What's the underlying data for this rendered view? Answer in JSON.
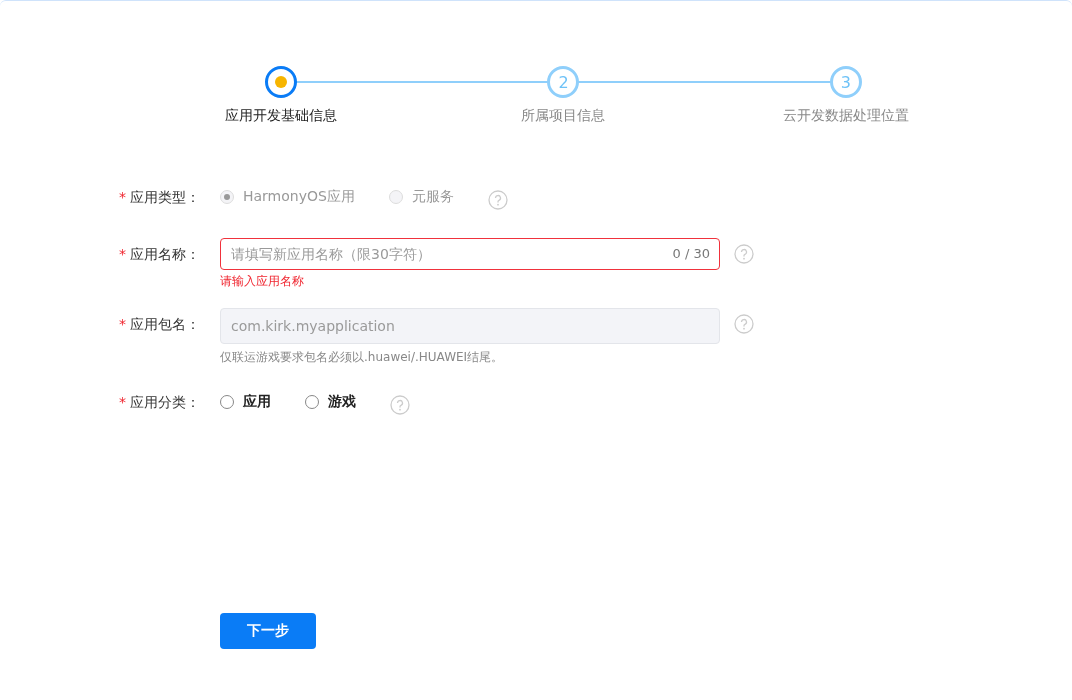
{
  "steps": [
    {
      "label": "应用开发基础信息",
      "current": true
    },
    {
      "label": "所属项目信息",
      "number": "2",
      "current": false
    },
    {
      "label": "云开发数据处理位置",
      "number": "3",
      "current": false
    }
  ],
  "form": {
    "rows": [
      {
        "kind": "radio",
        "label": "应用类型：",
        "required_mark": "*",
        "disabled": true,
        "options": [
          {
            "label": "HarmonyOS应用",
            "selected": true
          },
          {
            "label": "元服务",
            "selected": false
          }
        ]
      },
      {
        "kind": "input",
        "label": "应用名称：",
        "required_mark": "*",
        "placeholder": "请填写新应用名称（限30字符）",
        "counter": "0 / 30",
        "error": "请输入应用名称"
      },
      {
        "kind": "readonly",
        "label": "应用包名：",
        "required_mark": "*",
        "value": "com.kirk.myapplication",
        "hint": "仅联运游戏要求包名必须以.huawei/.HUAWEI结尾。"
      },
      {
        "kind": "radio",
        "label": "应用分类：",
        "required_mark": "*",
        "disabled": false,
        "options": [
          {
            "label": "应用",
            "selected": false
          },
          {
            "label": "游戏",
            "selected": false
          }
        ]
      }
    ]
  },
  "next_button": "下一步"
}
